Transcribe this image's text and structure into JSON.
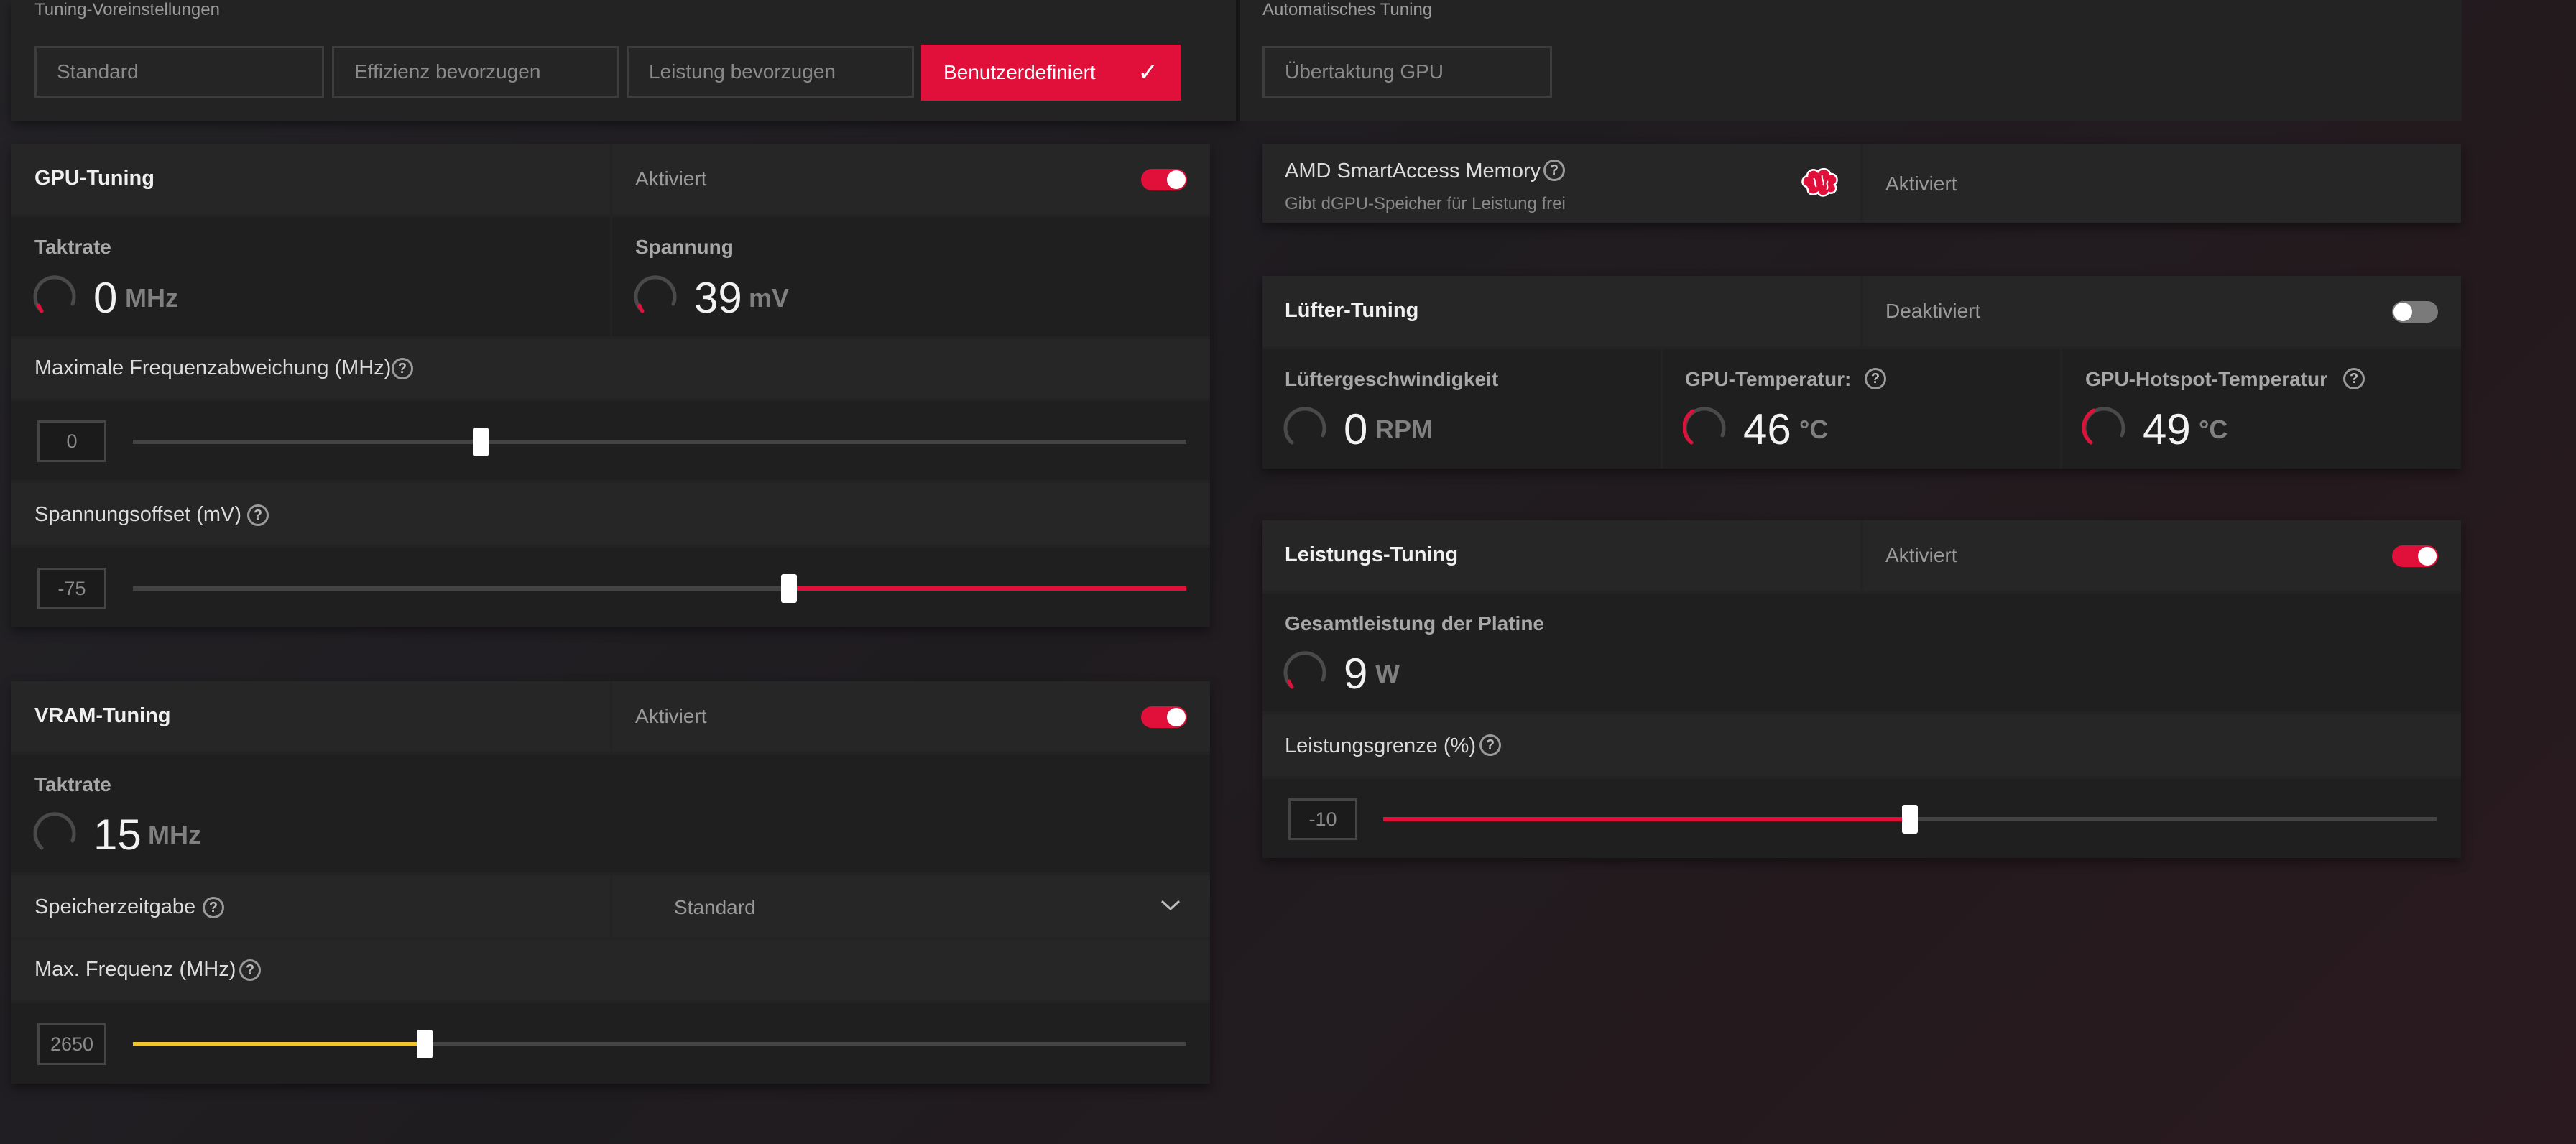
{
  "presets": {
    "section_label": "Tuning-Voreinstellungen",
    "items": [
      {
        "label": "Standard",
        "active": false
      },
      {
        "label": "Effizienz bevorzugen",
        "active": false
      },
      {
        "label": "Leistung bevorzugen",
        "active": false
      },
      {
        "label": "Benutzerdefiniert",
        "active": true
      }
    ],
    "check_icon": "checkmark-icon"
  },
  "auto_tuning": {
    "section_label": "Automatisches Tuning",
    "button_label": "Übertaktung GPU"
  },
  "gpu_tuning": {
    "title": "GPU-Tuning",
    "state_label": "Aktiviert",
    "enabled": true,
    "clock": {
      "label": "Taktrate",
      "value": "0",
      "unit": "MHz"
    },
    "voltage": {
      "label": "Spannung",
      "value": "39",
      "unit": "mV"
    },
    "max_freq_offset": {
      "label": "Maximale Frequenzabweichung (MHz)",
      "value": "0",
      "position_fraction": 0.33
    },
    "voltage_offset": {
      "label": "Spannungsoffset (mV)",
      "value": "-75",
      "position_fraction": 0.623
    }
  },
  "vram_tuning": {
    "title": "VRAM-Tuning",
    "state_label": "Aktiviert",
    "enabled": true,
    "clock": {
      "label": "Taktrate",
      "value": "15",
      "unit": "MHz"
    },
    "memory_timing": {
      "label": "Speicherzeitgabe",
      "selected": "Standard"
    },
    "max_freq": {
      "label": "Max. Frequenz (MHz)",
      "value": "2650",
      "position_fraction": 0.277
    }
  },
  "smart_access": {
    "title": "AMD SmartAccess Memory",
    "description": "Gibt dGPU-Speicher für Leistung frei",
    "state_label": "Aktiviert",
    "icon": "brain-icon"
  },
  "fan_tuning": {
    "title": "Lüfter-Tuning",
    "state_label": "Deaktiviert",
    "enabled": false,
    "fan_speed": {
      "label": "Lüftergeschwindigkeit",
      "value": "0",
      "unit": "RPM"
    },
    "gpu_temp": {
      "label": "GPU-Temperatur:",
      "value": "46",
      "unit": "°C"
    },
    "hotspot_temp": {
      "label": "GPU-Hotspot-Temperatur",
      "value": "49",
      "unit": "°C"
    }
  },
  "power_tuning": {
    "title": "Leistungs-Tuning",
    "state_label": "Aktiviert",
    "enabled": true,
    "board_power": {
      "label": "Gesamtleistung der Platine",
      "value": "9",
      "unit": "W"
    },
    "power_limit": {
      "label": "Leistungsgrenze (%)",
      "value": "-10",
      "position_fraction": 0.5
    }
  },
  "help_glyph": "?",
  "colors": {
    "accent": "#e0103a",
    "vram_slider": "#f2c230"
  }
}
